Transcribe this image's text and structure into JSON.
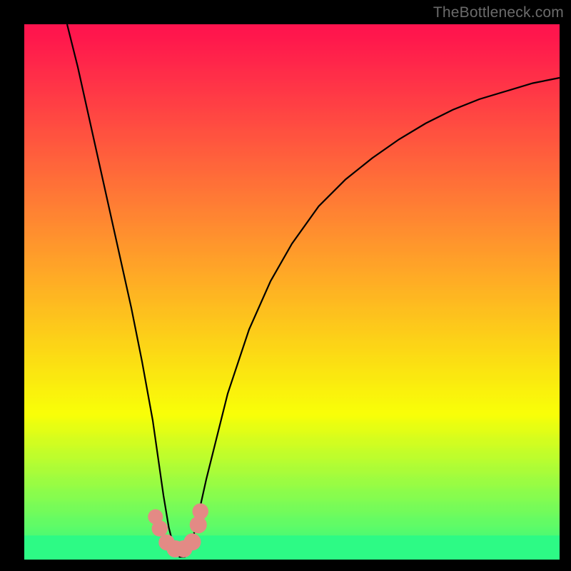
{
  "watermark": "TheBottleneck.com",
  "chart_data": {
    "type": "line",
    "title": "",
    "xlabel": "",
    "ylabel": "",
    "xlim": [
      0,
      100
    ],
    "ylim": [
      0,
      100
    ],
    "grid": false,
    "legend": false,
    "series": [
      {
        "name": "bottleneck-curve",
        "x": [
          8,
          10,
          12,
          14,
          16,
          18,
          20,
          22,
          24,
          25,
          26,
          27,
          28,
          29,
          30,
          31,
          32,
          34,
          38,
          42,
          46,
          50,
          55,
          60,
          65,
          70,
          75,
          80,
          85,
          90,
          95,
          100
        ],
        "values": [
          100,
          92,
          83,
          74,
          65,
          56,
          47,
          37,
          26,
          19,
          12,
          6,
          2,
          0.5,
          0.5,
          2,
          6,
          15,
          31,
          43,
          52,
          59,
          66,
          71,
          75,
          78.5,
          81.5,
          84,
          86,
          87.5,
          89,
          90
        ]
      }
    ],
    "markers": [
      {
        "name": "dot",
        "x": 24.5,
        "y": 8.0,
        "r": 1.4
      },
      {
        "name": "dot",
        "x": 25.3,
        "y": 5.8,
        "r": 1.5
      },
      {
        "name": "dot",
        "x": 26.6,
        "y": 3.2,
        "r": 1.5
      },
      {
        "name": "dot",
        "x": 28.2,
        "y": 2.0,
        "r": 1.6
      },
      {
        "name": "dot",
        "x": 29.8,
        "y": 2.0,
        "r": 1.6
      },
      {
        "name": "dot",
        "x": 31.4,
        "y": 3.3,
        "r": 1.6
      },
      {
        "name": "dot",
        "x": 32.5,
        "y": 6.5,
        "r": 1.6
      },
      {
        "name": "dot",
        "x": 32.9,
        "y": 9.0,
        "r": 1.5
      }
    ],
    "background_gradient_stops": [
      "#ff144e",
      "#ff154e",
      "#ff154d",
      "#ff164d",
      "#ff174c",
      "#ff184c",
      "#ff194c",
      "#ff1b4c",
      "#ff1d4b",
      "#ff1e4b",
      "#ff1f4b",
      "#ff214b",
      "#ff234a",
      "#ff244a",
      "#ff254a",
      "#ff274a",
      "#ff2949",
      "#ff2b49",
      "#ff2d48",
      "#ff2e48",
      "#ff2f48",
      "#ff3148",
      "#ff3347",
      "#ff3547",
      "#ff3646",
      "#ff3746",
      "#ff3946",
      "#ff3b45",
      "#ff3d45",
      "#ff3e44",
      "#ff3f44",
      "#ff4144",
      "#ff4343",
      "#ff4543",
      "#ff4742",
      "#ff4842",
      "#ff4942",
      "#ff4b41",
      "#ff4d41",
      "#ff4f40",
      "#ff5140",
      "#ff523f",
      "#ff533f",
      "#ff553f",
      "#ff573e",
      "#ff593e",
      "#ff5b3d",
      "#ff5c3d",
      "#ff5d3c",
      "#ff5f3c",
      "#ff613c",
      "#ff633b",
      "#ff653b",
      "#ff663a",
      "#ff673a",
      "#ff6939",
      "#ff6b39",
      "#ff6d38",
      "#ff6f38",
      "#ff7037",
      "#ff7137",
      "#ff7337",
      "#ff7536",
      "#ff7736",
      "#ff7935",
      "#ff7a35",
      "#ff7b34",
      "#ff7d34",
      "#ff7f33",
      "#ff8133",
      "#ff8332",
      "#ff8432",
      "#ff8531",
      "#ff8731",
      "#ff8930",
      "#ff8b30",
      "#ff8d2f",
      "#ff8e2f",
      "#ff8f2e",
      "#ff912e",
      "#ff932d",
      "#ff952d",
      "#ff972c",
      "#ff982b",
      "#ff992b",
      "#ff9b2a",
      "#ff9d2a",
      "#ff9f29",
      "#ffa129",
      "#ffa228",
      "#ffa328",
      "#ffa527",
      "#ffa727",
      "#ffa926",
      "#ffab25",
      "#ffac25",
      "#ffad24",
      "#ffaf24",
      "#feb123",
      "#feb323",
      "#feb522",
      "#feb621",
      "#feb721",
      "#feb920",
      "#febb20",
      "#febd1f",
      "#febf1f",
      "#fdc01e",
      "#fdc11d",
      "#fdc31d",
      "#fdc51c",
      "#fdc71c",
      "#fdc91b",
      "#fdca1a",
      "#fdcb1a",
      "#fdcd19",
      "#fccf19",
      "#fcd118",
      "#fcd318",
      "#fcd417",
      "#fcd516",
      "#fcd716",
      "#fcd915",
      "#fcdb15",
      "#fbdd14",
      "#fbde13",
      "#fbdf13",
      "#fbe112",
      "#fbe312",
      "#fbe511",
      "#fbe710",
      "#fae810",
      "#fae90f",
      "#faeb0f",
      "#faed0e",
      "#faef0d",
      "#faf10d",
      "#faf20c",
      "#faf30c",
      "#f9f50b",
      "#f9f70b",
      "#f9f90a",
      "#f9fb09",
      "#f9fc09",
      "#f9fd08",
      "#f8fe08",
      "#f6fe09",
      "#f1fe0c",
      "#ecfe0f",
      "#e8fe12",
      "#e6fe13",
      "#e3fe15",
      "#dffd18",
      "#dafd1b",
      "#d5fd1e",
      "#d3fd1f",
      "#d1fd21",
      "#ccfd23",
      "#c7fd26",
      "#c3fd29",
      "#c0fd2b",
      "#befd2c",
      "#b9fd2f",
      "#b5fd32",
      "#b0fd35",
      "#adfc36",
      "#abfc38",
      "#a7fc3b",
      "#a2fc3d",
      "#9dfc40",
      "#9bfc42",
      "#99fc43",
      "#94fc46",
      "#8ffc49",
      "#8bfc4c",
      "#88fc4d",
      "#86fc4f",
      "#81fc52",
      "#7dfb55",
      "#78fb57",
      "#76fb59",
      "#73fb5a",
      "#6ffb5d",
      "#6afb60",
      "#65fb63",
      "#63fb64",
      "#61fb66",
      "#5cfb69",
      "#57fb6b",
      "#53fb6e",
      "#50fa70",
      "#4efa71",
      "#49fa74",
      "#45fa77",
      "#40fa7a",
      "#3efa7b",
      "#3bfa7d",
      "#37fa80",
      "#32fa82",
      "#2dfa85"
    ],
    "green_band": {
      "y_from": 0,
      "y_to": 4.5
    },
    "marker_color": "#e38a85",
    "curve_color": "#000000"
  }
}
